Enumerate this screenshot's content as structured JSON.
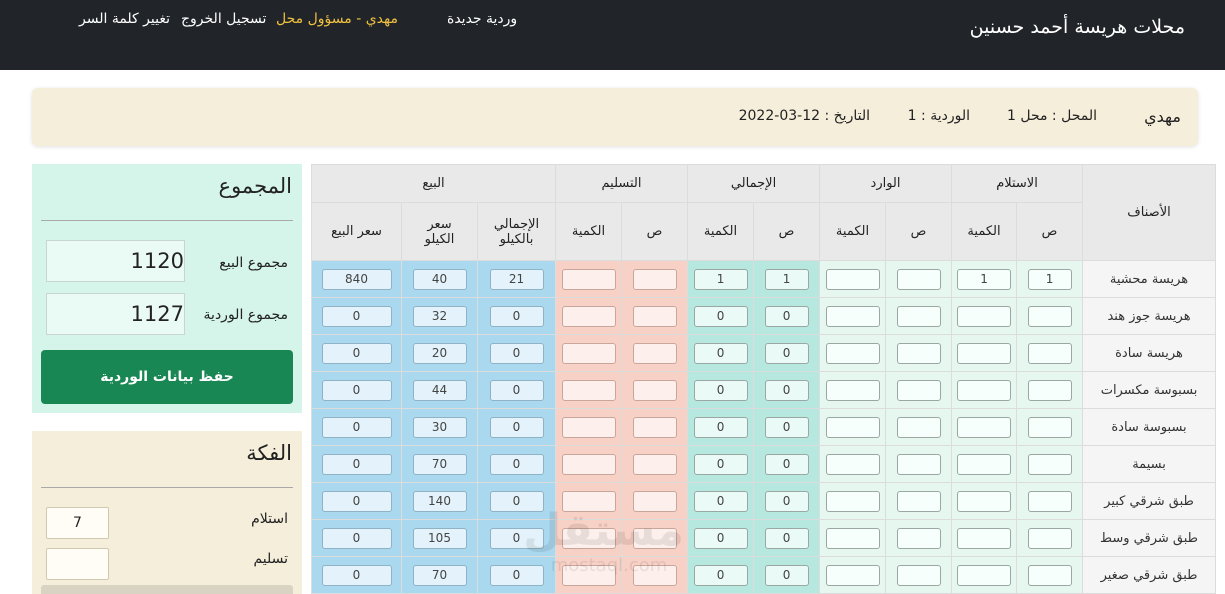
{
  "navbar": {
    "brand": "محلات هريسة أحمد حسنين",
    "new_shift": "وردية جديدة",
    "user": "مهدي - مسؤول محل",
    "logout": "تسجيل الخروج",
    "change_password": "تغيير كلمة السر"
  },
  "info": {
    "name": "مهدي",
    "shop": "المحل : محل 1",
    "shift": "الوردية : 1",
    "date": "التاريخ : 12-03-2022"
  },
  "table": {
    "groups": [
      "الاستلام",
      "الوارد",
      "الإجمالي",
      "التسليم",
      "البيع"
    ],
    "items_header": "الأصناف",
    "sub": {
      "pieces": "ص",
      "quantity": "الكمية",
      "total_per_kilo_line1": "الإجمالي",
      "total_per_kilo_line2": "بالكيلو",
      "kilo_price_line1": "سعر",
      "kilo_price_line2": "الكيلو",
      "sale_price": "سعر البيع"
    },
    "rows": [
      {
        "name": "هريسة محشية",
        "recv_p": "1",
        "recv_q": "1",
        "in_p": "",
        "in_q": "",
        "tot_p": "1",
        "tot_q": "1",
        "del_p": "",
        "del_q": "",
        "kilo_total": "21",
        "kilo_price": "40",
        "sale_price": "840"
      },
      {
        "name": "هريسة جوز هند",
        "recv_p": "",
        "recv_q": "",
        "in_p": "",
        "in_q": "",
        "tot_p": "0",
        "tot_q": "0",
        "del_p": "",
        "del_q": "",
        "kilo_total": "0",
        "kilo_price": "32",
        "sale_price": "0"
      },
      {
        "name": "هريسة سادة",
        "recv_p": "",
        "recv_q": "",
        "in_p": "",
        "in_q": "",
        "tot_p": "0",
        "tot_q": "0",
        "del_p": "",
        "del_q": "",
        "kilo_total": "0",
        "kilo_price": "20",
        "sale_price": "0"
      },
      {
        "name": "بسبوسة مكسرات",
        "recv_p": "",
        "recv_q": "",
        "in_p": "",
        "in_q": "",
        "tot_p": "0",
        "tot_q": "0",
        "del_p": "",
        "del_q": "",
        "kilo_total": "0",
        "kilo_price": "44",
        "sale_price": "0"
      },
      {
        "name": "بسبوسة سادة",
        "recv_p": "",
        "recv_q": "",
        "in_p": "",
        "in_q": "",
        "tot_p": "0",
        "tot_q": "0",
        "del_p": "",
        "del_q": "",
        "kilo_total": "0",
        "kilo_price": "30",
        "sale_price": "0"
      },
      {
        "name": "بسيمة",
        "recv_p": "",
        "recv_q": "",
        "in_p": "",
        "in_q": "",
        "tot_p": "0",
        "tot_q": "0",
        "del_p": "",
        "del_q": "",
        "kilo_total": "0",
        "kilo_price": "70",
        "sale_price": "0"
      },
      {
        "name": "طبق شرقي كبير",
        "recv_p": "",
        "recv_q": "",
        "in_p": "",
        "in_q": "",
        "tot_p": "0",
        "tot_q": "0",
        "del_p": "",
        "del_q": "",
        "kilo_total": "0",
        "kilo_price": "140",
        "sale_price": "0"
      },
      {
        "name": "طبق شرقي وسط",
        "recv_p": "",
        "recv_q": "",
        "in_p": "",
        "in_q": "",
        "tot_p": "0",
        "tot_q": "0",
        "del_p": "",
        "del_q": "",
        "kilo_total": "0",
        "kilo_price": "105",
        "sale_price": "0"
      },
      {
        "name": "طبق شرقي صغير",
        "recv_p": "",
        "recv_q": "",
        "in_p": "",
        "in_q": "",
        "tot_p": "0",
        "tot_q": "0",
        "del_p": "",
        "del_q": "",
        "kilo_total": "0",
        "kilo_price": "70",
        "sale_price": "0"
      }
    ]
  },
  "totals": {
    "title": "المجموع",
    "sales_label": "مجموع البيع",
    "sales_value": "1120",
    "shift_label": "مجموع الوردية",
    "shift_value": "1127",
    "save_button": "حفظ بيانات الوردية"
  },
  "change": {
    "title": "الفكة",
    "receive_label": "استلام",
    "receive_value": "7",
    "deliver_label": "تسليم",
    "deliver_value": ""
  },
  "watermark": {
    "main": "مستقل",
    "sub": "mostaql.com"
  },
  "colors": {
    "navbar": "#212529",
    "info_bar": "#f5eedb",
    "receive_bg": "#e6f7f0",
    "total_bg": "#b7e8df",
    "delivery_bg": "#f7d0c6",
    "sale_bg": "#a9d8ef",
    "totals_panel": "#d5f5ea",
    "save_button": "#198754",
    "user_highlight": "#f0c040"
  }
}
